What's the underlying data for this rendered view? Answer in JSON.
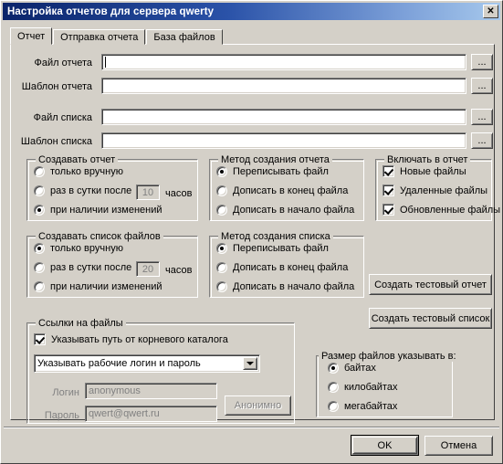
{
  "window": {
    "title": "Настройка отчетов для сервера qwerty",
    "close_label": "✕"
  },
  "tabs": [
    {
      "label": "Отчет",
      "active": true
    },
    {
      "label": "Отправка отчета",
      "active": false
    },
    {
      "label": "База файлов",
      "active": false
    }
  ],
  "fields": {
    "report_file": {
      "label": "Файл отчета",
      "value": "",
      "browse": "..."
    },
    "report_template": {
      "label": "Шаблон отчета",
      "value": "",
      "browse": "..."
    },
    "list_file": {
      "label": "Файл списка",
      "value": "",
      "browse": "..."
    },
    "list_template": {
      "label": "Шаблон списка",
      "value": "",
      "browse": "..."
    }
  },
  "create_report": {
    "title": "Создавать отчет",
    "options": [
      {
        "label": "только вручную",
        "selected": false
      },
      {
        "label": "раз в сутки после",
        "selected": false
      },
      {
        "label": "при наличии изменений",
        "selected": true
      }
    ],
    "hours_value": "10",
    "hours_suffix": "часов"
  },
  "report_method": {
    "title": "Метод создания отчета",
    "options": [
      {
        "label": "Переписывать файл",
        "selected": true
      },
      {
        "label": "Дописать в конец файла",
        "selected": false
      },
      {
        "label": "Дописать в начало файла",
        "selected": false
      }
    ]
  },
  "include_in_report": {
    "title": "Включать в отчет",
    "options": [
      {
        "label": "Новые файлы",
        "checked": true
      },
      {
        "label": "Удаленные файлы",
        "checked": true
      },
      {
        "label": "Обновленные файлы",
        "checked": true
      }
    ]
  },
  "create_list": {
    "title": "Создавать список файлов",
    "options": [
      {
        "label": "только вручную",
        "selected": true
      },
      {
        "label": "раз в сутки после",
        "selected": false
      },
      {
        "label": "при наличии изменений",
        "selected": false
      }
    ],
    "hours_value": "20",
    "hours_suffix": "часов"
  },
  "list_method": {
    "title": "Метод создания списка",
    "options": [
      {
        "label": "Переписывать файл",
        "selected": true
      },
      {
        "label": "Дописать в конец файла",
        "selected": false
      },
      {
        "label": "Дописать в начало файла",
        "selected": false
      }
    ]
  },
  "test_buttons": {
    "test_report": "Создать тестовый отчет",
    "test_list": "Создать тестовый список"
  },
  "file_links": {
    "title": "Ссылки на файлы",
    "root_path_label": "Указывать путь от корневого каталога",
    "root_path_checked": true,
    "credentials_mode": "Указывать рабочие логин и пароль",
    "login_label": "Логин",
    "login_value": "anonymous",
    "password_label": "Пароль",
    "password_value": "qwert@qwert.ru",
    "anonymous_button": "Анонимно"
  },
  "file_size": {
    "title": "Размер файлов указывать в:",
    "options": [
      {
        "label": "байтах",
        "selected": true
      },
      {
        "label": "килобайтах",
        "selected": false
      },
      {
        "label": "мегабайтах",
        "selected": false
      }
    ]
  },
  "dialog_buttons": {
    "ok": "OK",
    "cancel": "Отмена"
  }
}
